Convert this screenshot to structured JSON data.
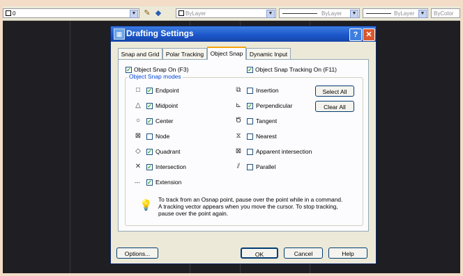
{
  "toolbar": {
    "layer_value": "0",
    "color_label": "ByLayer",
    "linetype_label": "ByLayer",
    "lineweight_label": "ByLayer",
    "plotstyle_label": "ByColor"
  },
  "dialog": {
    "title": "Drafting Settings",
    "help_btn": "?",
    "close_btn": "✕",
    "tabs": [
      "Snap and Grid",
      "Polar Tracking",
      "Object Snap",
      "Dynamic Input"
    ],
    "active_tab": "Object Snap",
    "osnap_on": {
      "label": "Object Snap On (F3)",
      "checked": true
    },
    "otrack_on": {
      "label": "Object Snap Tracking On (F11)",
      "checked": true
    },
    "group_title": "Object Snap modes",
    "modes_left": [
      {
        "symbol": "□",
        "label": "Endpoint",
        "checked": true
      },
      {
        "symbol": "△",
        "label": "Midpoint",
        "checked": true
      },
      {
        "symbol": "○",
        "label": "Center",
        "checked": true
      },
      {
        "symbol": "⊠",
        "label": "Node",
        "checked": false
      },
      {
        "symbol": "◇",
        "label": "Quadrant",
        "checked": true
      },
      {
        "symbol": "✕",
        "label": "Intersection",
        "checked": true
      },
      {
        "symbol": "---",
        "label": "Extension",
        "checked": true
      }
    ],
    "modes_right": [
      {
        "symbol": "⧉",
        "label": "Insertion",
        "checked": false
      },
      {
        "symbol": "⊾",
        "label": "Perpendicular",
        "checked": true
      },
      {
        "symbol": "Ծ",
        "label": "Tangent",
        "checked": false
      },
      {
        "symbol": "⧖",
        "label": "Nearest",
        "checked": false
      },
      {
        "symbol": "⊠",
        "label": "Apparent intersection",
        "checked": false
      },
      {
        "symbol": "⫽",
        "label": "Parallel",
        "checked": false
      }
    ],
    "select_all": "Select All",
    "clear_all": "Clear All",
    "hint": "To track from an Osnap point, pause over the point while in a command.  A tracking vector appears when you move the cursor. To stop tracking, pause over the point again.",
    "options_btn": "Options...",
    "ok_btn": "OK",
    "cancel_btn": "Cancel",
    "help_button": "Help"
  }
}
